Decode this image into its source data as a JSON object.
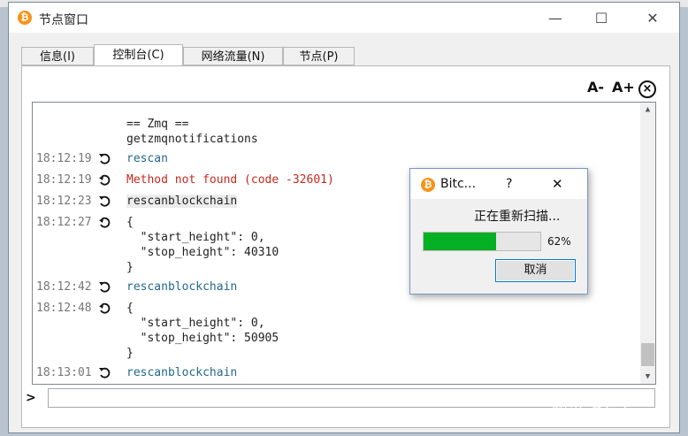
{
  "window": {
    "title": "节点窗口",
    "controls": {
      "minimize": "—",
      "maximize": "☐",
      "close": "✕"
    }
  },
  "tabs": [
    {
      "label": "信息(I)",
      "active": false
    },
    {
      "label": "控制台(C)",
      "active": true
    },
    {
      "label": "网络流量(N)",
      "active": false
    },
    {
      "label": "节点(P)",
      "active": false
    }
  ],
  "console_toolbar": {
    "font_smaller": "A-",
    "font_larger": "A+",
    "clear": "×"
  },
  "console": {
    "lines": [
      {
        "time": "",
        "icon": "",
        "text": "== Zmq ==",
        "style": "normal"
      },
      {
        "time": "",
        "icon": "",
        "text": "getzmqnotifications",
        "style": "normal"
      },
      {
        "time": "18:12:19",
        "icon": "request-arrow-icon",
        "text": "rescan",
        "style": "cmd"
      },
      {
        "time": "18:12:19",
        "icon": "reply-arrow-icon",
        "text": "Method not found (code -32601)",
        "style": "err"
      },
      {
        "time": "18:12:23",
        "icon": "request-arrow-icon",
        "text": "rescanblockchain",
        "style": "hl"
      },
      {
        "time": "18:12:27",
        "icon": "reply-arrow-icon",
        "text": "{",
        "style": "normal"
      },
      {
        "time": "",
        "icon": "",
        "text": "  \"start_height\": 0,",
        "style": "normal"
      },
      {
        "time": "",
        "icon": "",
        "text": "  \"stop_height\": 40310",
        "style": "normal"
      },
      {
        "time": "",
        "icon": "",
        "text": "}",
        "style": "normal"
      },
      {
        "time": "18:12:42",
        "icon": "request-arrow-icon",
        "text": "rescanblockchain",
        "style": "cmd"
      },
      {
        "time": "18:12:48",
        "icon": "reply-arrow-icon",
        "text": "{",
        "style": "normal"
      },
      {
        "time": "",
        "icon": "",
        "text": "  \"start_height\": 0,",
        "style": "normal"
      },
      {
        "time": "",
        "icon": "",
        "text": "  \"stop_height\": 50905",
        "style": "normal"
      },
      {
        "time": "",
        "icon": "",
        "text": "}",
        "style": "normal"
      },
      {
        "time": "18:13:01",
        "icon": "request-arrow-icon",
        "text": "rescanblockchain",
        "style": "cmd"
      }
    ],
    "prompt": ">",
    "input_value": ""
  },
  "dialog": {
    "title": "Bitc...",
    "help": "?",
    "close": "✕",
    "message": "正在重新扫描...",
    "progress_percent": 62,
    "progress_label": "62%",
    "cancel_label": "取消"
  },
  "watermark": "知乎 @Lotus",
  "colors": {
    "bitcoin": "#f7931a",
    "command": "#23698b",
    "error": "#c8281e",
    "progress": "#06b025",
    "focus": "#0078d7"
  }
}
